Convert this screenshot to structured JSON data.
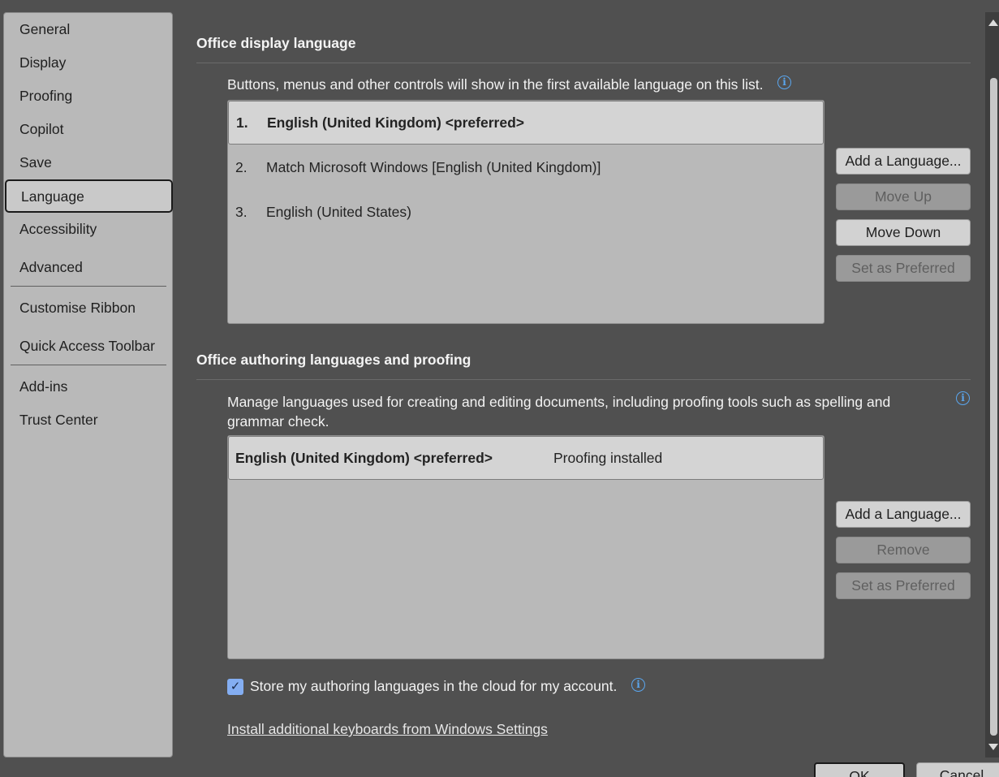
{
  "sidebar": {
    "items": [
      {
        "label": "General"
      },
      {
        "label": "Display"
      },
      {
        "label": "Proofing"
      },
      {
        "label": "Copilot"
      },
      {
        "label": "Save"
      },
      {
        "label": "Language",
        "selected": true
      },
      {
        "label": "Accessibility"
      },
      {
        "label": "Advanced"
      },
      {
        "label": "Customise Ribbon"
      },
      {
        "label": "Quick Access Toolbar"
      },
      {
        "label": "Add-ins"
      },
      {
        "label": "Trust Center"
      }
    ]
  },
  "display_language": {
    "title": "Office display language",
    "description": "Buttons, menus and other controls will show in the first available language on this list.",
    "info_icon": "info-icon",
    "rows": [
      {
        "num": "1.",
        "text": "English (United Kingdom) <preferred>",
        "selected": true
      },
      {
        "num": "2.",
        "text": "Match Microsoft Windows [English (United Kingdom)]"
      },
      {
        "num": "3.",
        "text": "English (United States)"
      }
    ],
    "buttons": {
      "add": "Add a Language...",
      "move_up": "Move Up",
      "move_down": "Move Down",
      "set_preferred": "Set as Preferred"
    }
  },
  "authoring": {
    "title": "Office authoring languages and proofing",
    "description": "Manage languages used for creating and editing documents, including proofing tools such as spelling and grammar check.",
    "rows": [
      {
        "text": "English (United Kingdom) <preferred>",
        "status": "Proofing installed",
        "selected": true
      }
    ],
    "buttons": {
      "add": "Add a Language...",
      "remove": "Remove",
      "set_preferred": "Set as Preferred"
    },
    "store_cloud_label": "Store my authoring languages in the cloud for my account.",
    "store_cloud_checked": true,
    "install_keyboards_link": "Install additional keyboards from Windows Settings"
  },
  "footer": {
    "ok": "OK",
    "cancel": "Cancel"
  },
  "colors": {
    "background": "#505050",
    "accent": "#5aa6ee",
    "checkbox": "#84aef2"
  }
}
